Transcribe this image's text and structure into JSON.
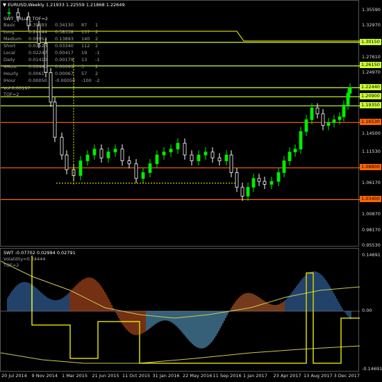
{
  "chart_header": {
    "symbol_label": "EURUSD,Weekly",
    "ohlc": "1.21933 1.22559 1.21868 1.22649"
  },
  "indicator_title": "SWT_SRLuti_TOF=2",
  "stats_rows": [
    {
      "name": "Basic",
      "v1": "0.39493",
      "v2": "0.34130",
      "n": "87",
      "d": "1"
    },
    {
      "name": "Long",
      "v1": "0.24444",
      "v2": "0.38338",
      "n": "157",
      "d": "2"
    },
    {
      "name": "Medium",
      "v1": "0.09953",
      "v2": "0.13893",
      "n": "140",
      "d": "2"
    },
    {
      "name": "Short",
      "v1": "0.03523",
      "v2": "0.03340",
      "n": "112",
      "d": "2"
    },
    {
      "name": "Local",
      "v1": "0.02247",
      "v2": "0.00417",
      "n": "19",
      "d": "-1"
    },
    {
      "name": "Daily",
      "v1": "0.01410",
      "v2": "0.00179",
      "n": "13",
      "d": "-1"
    },
    {
      "name": "4Hour",
      "v1": "0.00440",
      "v2": "0.00041",
      "n": "3",
      "d": "2"
    },
    {
      "name": "Hourly",
      "v1": "0.00617",
      "v2": "0.00067",
      "n": "57",
      "d": "2"
    },
    {
      "name": "IHour",
      "v1": "0.00050",
      "v2": "-0.00050",
      "n": "-100",
      "d": "-2"
    }
  ],
  "vol_label": "Vol 0.00197",
  "tof_label": "TOF=2",
  "price_axis": [
    "1.35590",
    "1.32970",
    "1.30150",
    "1.27610",
    "1.26150",
    "1.24970",
    "1.22440",
    "1.20900",
    "1.19350",
    "1.16530",
    "1.14500",
    "1.11530",
    "1.08800",
    "1.06170",
    "1.03400",
    "1.00870",
    "0.98170",
    "0.95530"
  ],
  "level_badges": [
    {
      "price": "1.30150",
      "color": "#ccff33"
    },
    {
      "price": "1.26150",
      "color": "#ccff33"
    },
    {
      "price": "1.22440",
      "color": "#ccff33"
    },
    {
      "price": "1.20900",
      "color": "#ccff33"
    },
    {
      "price": "1.19350",
      "color": "#ccff33"
    },
    {
      "price": "1.16530",
      "color": "#ff6600"
    },
    {
      "price": "1.08800",
      "color": "#ff6600"
    },
    {
      "price": "1.03400",
      "color": "#ff6600"
    }
  ],
  "sub_header": "SWT -0.07702 0.02994 0.02791",
  "sub_volatility": "Volatility=0.24444",
  "sub_tof": "TOF=2",
  "sub_axis": [
    "0.14691",
    "0.00",
    "-0.14691"
  ],
  "date_axis": [
    "20 Jul 2014",
    "9 Nov 2014",
    "1 Mar 2015",
    "21 Jun 2015",
    "11 Oct 2015",
    "31 Jan 2016",
    "22 May 2016",
    "11 Sep 2016",
    "1 Jan 2017",
    "23 Apr 2017",
    "13 Aug 2017",
    "3 Dec 2017"
  ],
  "colors": {
    "bull": "#00ee00",
    "bear": "#ffffff",
    "level_green": "#ccff33",
    "level_orange": "#ff6600",
    "signal": "#ffff00"
  }
}
